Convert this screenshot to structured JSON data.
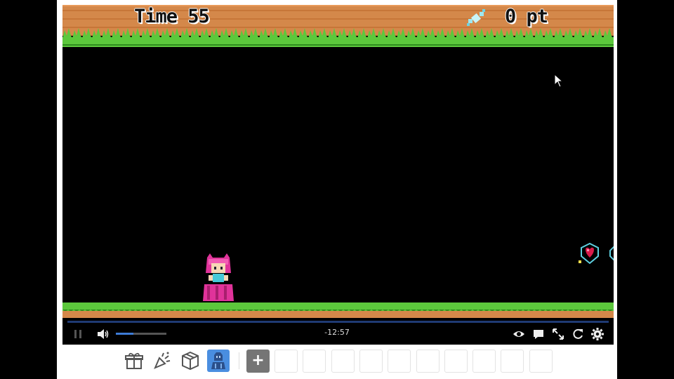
{
  "hud": {
    "time_label": "Time 55",
    "score_label": "0 pt"
  },
  "player_controls": {
    "time_remaining": "-12:57",
    "video_progress": 0.0,
    "volume_level": 0.35
  },
  "toolbar": {
    "add_label": "+",
    "tools": [
      "gift-icon",
      "party-popper-icon",
      "box-icon",
      "character-icon"
    ],
    "active_tool": "character-icon",
    "empty_slot_count": 10
  },
  "colors": {
    "accent": "#3d7bd6",
    "active_tool_bg": "#4a8ee0",
    "grass": "#5cc83c",
    "dirt": "#d4884a",
    "player_hair": "#e0339a"
  }
}
